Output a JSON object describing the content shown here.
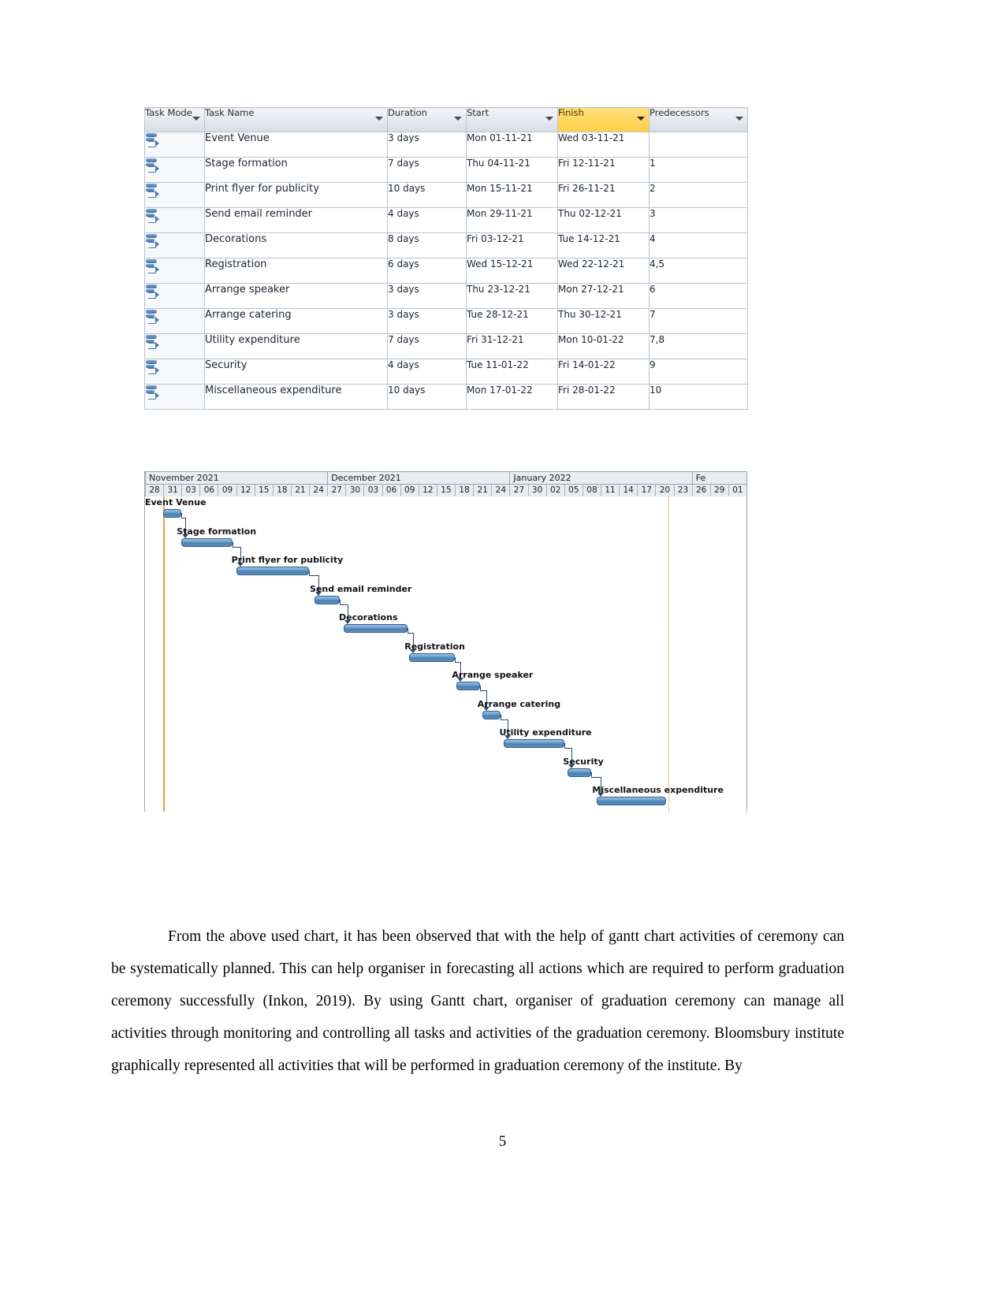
{
  "project_table": {
    "columns": [
      {
        "label": "Task Mode",
        "highlighted": false,
        "has_filter": true
      },
      {
        "label": "Task Name",
        "highlighted": false,
        "has_filter": true
      },
      {
        "label": "Duration",
        "highlighted": false,
        "has_filter": true
      },
      {
        "label": "Start",
        "highlighted": false,
        "has_filter": true
      },
      {
        "label": "Finish",
        "highlighted": true,
        "has_filter": true
      },
      {
        "label": "Predecessors",
        "highlighted": false,
        "has_filter": true
      }
    ],
    "rows": [
      {
        "mode_icon": "auto-schedule-icon",
        "task_name": "Event Venue",
        "duration": "3 days",
        "start": "Mon 01-11-21",
        "finish": "Wed 03-11-21",
        "predecessors": ""
      },
      {
        "mode_icon": "auto-schedule-icon",
        "task_name": "Stage formation",
        "duration": "7 days",
        "start": "Thu 04-11-21",
        "finish": "Fri 12-11-21",
        "predecessors": "1"
      },
      {
        "mode_icon": "auto-schedule-icon",
        "task_name": "Print flyer for publicity",
        "duration": "10 days",
        "start": "Mon 15-11-21",
        "finish": "Fri 26-11-21",
        "predecessors": "2"
      },
      {
        "mode_icon": "auto-schedule-icon",
        "task_name": "Send email reminder",
        "duration": "4 days",
        "start": "Mon 29-11-21",
        "finish": "Thu 02-12-21",
        "predecessors": "3"
      },
      {
        "mode_icon": "auto-schedule-icon",
        "task_name": "Decorations",
        "duration": "8 days",
        "start": "Fri 03-12-21",
        "finish": "Tue 14-12-21",
        "predecessors": "4"
      },
      {
        "mode_icon": "auto-schedule-icon",
        "task_name": "Registration",
        "duration": "6 days",
        "start": "Wed 15-12-21",
        "finish": "Wed 22-12-21",
        "predecessors": "4,5"
      },
      {
        "mode_icon": "auto-schedule-icon",
        "task_name": "Arrange speaker",
        "duration": "3 days",
        "start": "Thu 23-12-21",
        "finish": "Mon 27-12-21",
        "predecessors": "6"
      },
      {
        "mode_icon": "auto-schedule-icon",
        "task_name": "Arrange catering",
        "duration": "3 days",
        "start": "Tue 28-12-21",
        "finish": "Thu 30-12-21",
        "predecessors": "7"
      },
      {
        "mode_icon": "auto-schedule-icon",
        "task_name": "Utility expenditure",
        "duration": "7 days",
        "start": "Fri 31-12-21",
        "finish": "Mon 10-01-22",
        "predecessors": "7,8"
      },
      {
        "mode_icon": "auto-schedule-icon",
        "task_name": "Security",
        "duration": "4 days",
        "start": "Tue 11-01-22",
        "finish": "Fri 14-01-22",
        "predecessors": "9"
      },
      {
        "mode_icon": "auto-schedule-icon",
        "task_name": "Miscellaneous expenditure",
        "duration": "10 days",
        "start": "Mon 17-01-22",
        "finish": "Fri 28-01-22",
        "predecessors": "10"
      }
    ]
  },
  "chart_data": {
    "type": "bar",
    "chart_kind": "gantt",
    "title": "",
    "xlabel": "",
    "ylabel": "",
    "timescale": {
      "months": [
        {
          "label": "November 2021",
          "start_tick": 1,
          "tick_span": 10
        },
        {
          "label": "December 2021",
          "start_tick": 11,
          "tick_span": 10
        },
        {
          "label": "January 2022",
          "start_tick": 21,
          "tick_span": 10
        },
        {
          "label": "Fe",
          "start_tick": 31,
          "tick_span": 1
        }
      ],
      "day_ticks": [
        "28",
        "31",
        "03",
        "06",
        "09",
        "12",
        "15",
        "18",
        "21",
        "24",
        "27",
        "30",
        "03",
        "06",
        "09",
        "12",
        "15",
        "18",
        "21",
        "24",
        "27",
        "30",
        "02",
        "05",
        "08",
        "11",
        "14",
        "17",
        "20",
        "23",
        "26",
        "29",
        "01"
      ],
      "tick_interval_days": 3
    },
    "tasks": [
      {
        "name": "Event Venue",
        "start": "2021-11-01",
        "finish": "2021-11-03",
        "duration_days": 3,
        "bar_start_tick": 1.0,
        "bar_end_tick": 2.0
      },
      {
        "name": "Stage formation",
        "start": "2021-11-04",
        "finish": "2021-11-12",
        "duration_days": 7,
        "bar_start_tick": 2.0,
        "bar_end_tick": 4.8
      },
      {
        "name": "Print flyer for publicity",
        "start": "2021-11-15",
        "finish": "2021-11-26",
        "duration_days": 10,
        "bar_start_tick": 5.0,
        "bar_end_tick": 9.0
      },
      {
        "name": "Send email reminder",
        "start": "2021-11-29",
        "finish": "2021-12-02",
        "duration_days": 4,
        "bar_start_tick": 9.3,
        "bar_end_tick": 10.7
      },
      {
        "name": "Decorations",
        "start": "2021-12-03",
        "finish": "2021-12-14",
        "duration_days": 8,
        "bar_start_tick": 10.9,
        "bar_end_tick": 14.4
      },
      {
        "name": "Registration",
        "start": "2021-12-15",
        "finish": "2021-12-22",
        "duration_days": 6,
        "bar_start_tick": 14.5,
        "bar_end_tick": 17.0
      },
      {
        "name": "Arrange speaker",
        "start": "2021-12-23",
        "finish": "2021-12-27",
        "duration_days": 3,
        "bar_start_tick": 17.1,
        "bar_end_tick": 18.4
      },
      {
        "name": "Arrange catering",
        "start": "2021-12-28",
        "finish": "2021-12-30",
        "duration_days": 3,
        "bar_start_tick": 18.5,
        "bar_end_tick": 19.5
      },
      {
        "name": "Utility expenditure",
        "start": "2021-12-31",
        "finish": "2022-01-10",
        "duration_days": 7,
        "bar_start_tick": 19.7,
        "bar_end_tick": 23.0
      },
      {
        "name": "Security",
        "start": "2022-01-11",
        "finish": "2022-01-14",
        "duration_days": 4,
        "bar_start_tick": 23.2,
        "bar_end_tick": 24.5
      },
      {
        "name": "Miscellaneous expenditure",
        "start": "2022-01-17",
        "finish": "2022-01-28",
        "duration_days": 10,
        "bar_start_tick": 24.8,
        "bar_end_tick": 28.6
      }
    ],
    "markers": {
      "today_line_tick": 1.0,
      "project_finish_line_tick": 28.7
    },
    "colors": {
      "bar_fill": "#6b9bc8",
      "bar_border": "#2f5f8f",
      "link": "#2c4a66",
      "today_line": "#e8a04a",
      "header_bg": "#e9ecf0",
      "highlight_header": "#ffd65c"
    },
    "grid": false,
    "legend": "none"
  },
  "body": {
    "paragraph": "From the above used chart, it has been observed that with the help of gantt chart activities of ceremony can be systematically planned. This can help organiser in forecasting all actions which are required to perform graduation ceremony successfully (Inkon, 2019). By using Gantt chart, organiser of graduation ceremony can manage all activities through monitoring and controlling all tasks and activities of the graduation ceremony. Bloomsbury institute graphically represented all activities that will be performed in graduation ceremony of the institute. By",
    "page_number": "5"
  }
}
